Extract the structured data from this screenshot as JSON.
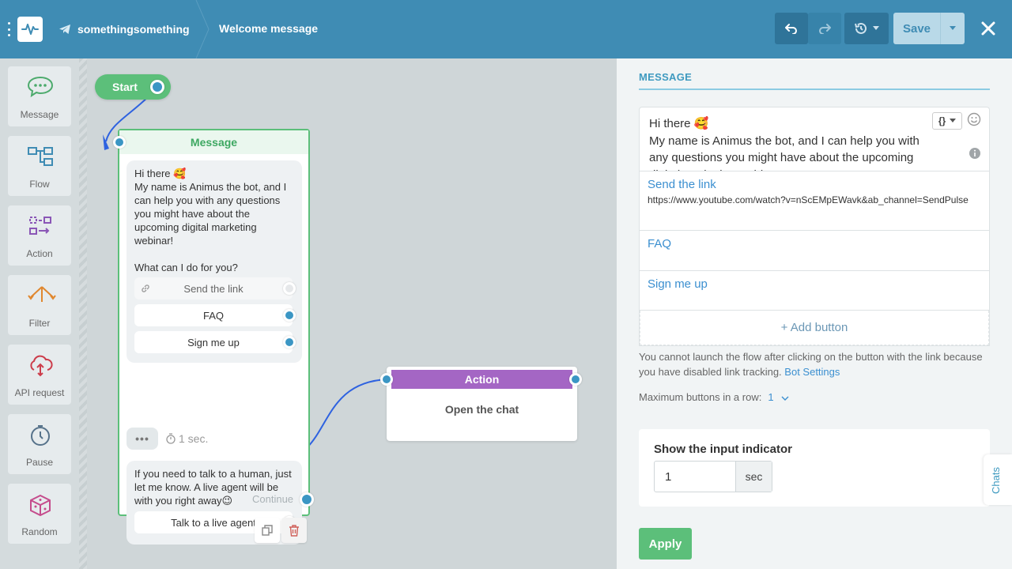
{
  "header": {
    "bot_name": "somethingsomething",
    "flow_name": "Welcome message",
    "save_label": "Save"
  },
  "palette": {
    "items": [
      {
        "label": "Message",
        "icon": "message-icon"
      },
      {
        "label": "Flow",
        "icon": "flow-icon"
      },
      {
        "label": "Action",
        "icon": "action-icon"
      },
      {
        "label": "Filter",
        "icon": "filter-icon"
      },
      {
        "label": "API request",
        "icon": "api-request-icon"
      },
      {
        "label": "Pause",
        "icon": "pause-icon"
      },
      {
        "label": "Random",
        "icon": "random-icon"
      }
    ]
  },
  "canvas": {
    "start_label": "Start",
    "message_node": {
      "title": "Message",
      "text1": "Hi there 🥰\nMy name is Animus the bot, and I can help you with any questions you might have about the upcoming digital marketing webinar!\n\nWhat can I do for you?",
      "buttons": [
        "Send the link",
        "FAQ",
        "Sign me up"
      ],
      "delay_text": "1 sec.",
      "text2": "If you need to talk to a human, just let me know. A live agent will be with you right away😉",
      "live_button": "Talk to a live agent",
      "continue_label": "Continue"
    },
    "action_node": {
      "title": "Action",
      "body": "Open the chat"
    }
  },
  "panel": {
    "title": "MESSAGE",
    "editor_text": "Hi there 🥰\nMy name is Animus the bot, and I can help you with any questions you might have about the upcoming digital marketing webinar!",
    "vars_label": "{}",
    "buttons": [
      {
        "label": "Send the link",
        "url": "https://www.youtube.com/watch?v=nScEMpEWavk&ab_channel=SendPulse"
      },
      {
        "label": "FAQ",
        "url": ""
      },
      {
        "label": "Sign me up",
        "url": ""
      }
    ],
    "add_button": "+ Add button",
    "note": "You cannot launch the flow after clicking on the button with the link because you have disabled link tracking.",
    "note_link": "Bot Settings",
    "max_buttons_label": "Maximum buttons in a row:",
    "max_buttons_value": "1",
    "input_indicator_title": "Show the input indicator",
    "input_indicator_value": "1",
    "input_indicator_unit": "sec",
    "apply_label": "Apply",
    "chats_tab": "Chats"
  },
  "colors": {
    "topbar": "#3f8cb4",
    "green": "#5cbf7a",
    "purple": "#a466c4",
    "link": "#3b8fd0"
  }
}
